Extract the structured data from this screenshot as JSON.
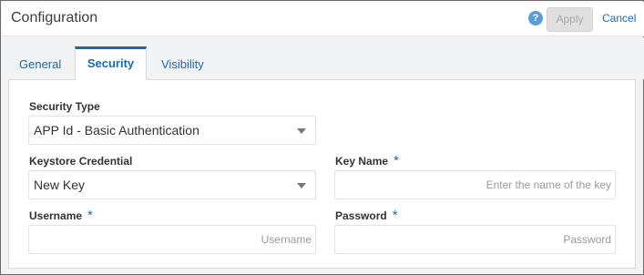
{
  "header": {
    "title": "Configuration",
    "help_icon_glyph": "?",
    "apply_label": "Apply",
    "cancel_label": "Cancel"
  },
  "tabs": [
    {
      "label": "General",
      "active": false
    },
    {
      "label": "Security",
      "active": true
    },
    {
      "label": "Visibility",
      "active": false
    }
  ],
  "form": {
    "security_type": {
      "label": "Security Type",
      "value": "APP Id - Basic Authentication"
    },
    "keystore_credential": {
      "label": "Keystore Credential",
      "value": "New Key"
    },
    "key_name": {
      "label": "Key Name",
      "required_mark": "*",
      "value": "",
      "placeholder": "Enter the name of the key"
    },
    "username": {
      "label": "Username",
      "required_mark": "*",
      "value": "",
      "placeholder": "Username"
    },
    "password": {
      "label": "Password",
      "required_mark": "*",
      "value": "",
      "placeholder": "Password"
    }
  },
  "colors": {
    "accent": "#1f6ba5",
    "help_icon": "#5b9bd5",
    "disabled_button": "#e0e0e0"
  },
  "icons": {
    "help": "help-icon",
    "dropdown": "chevron-down-icon"
  }
}
